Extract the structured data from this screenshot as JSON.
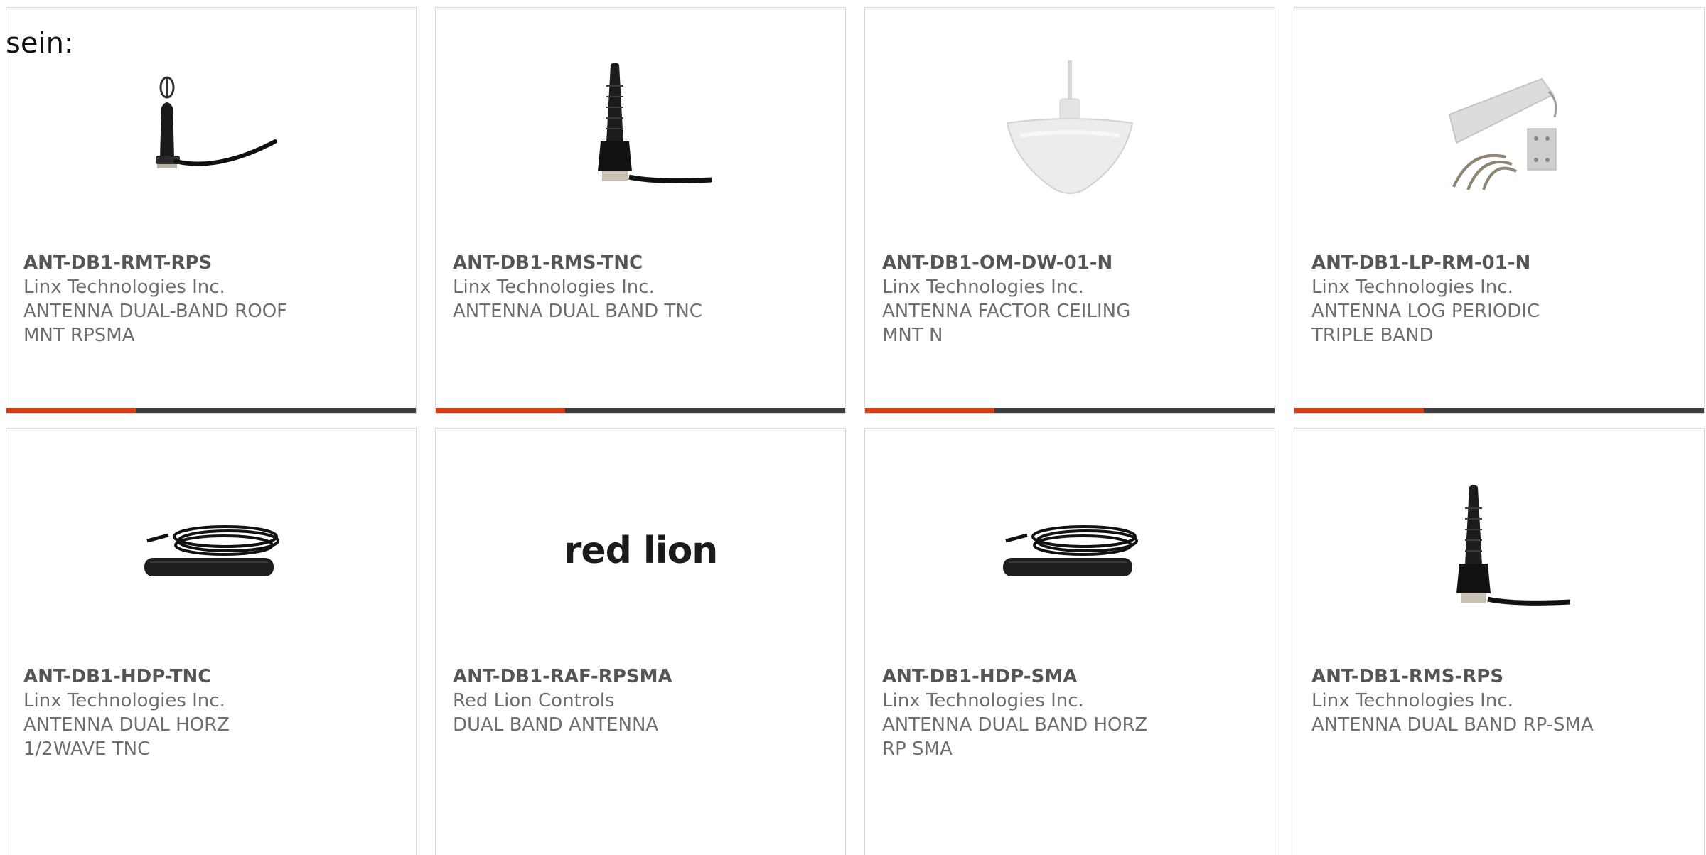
{
  "intro": {
    "text": "sein:"
  },
  "products": [
    {
      "part": "ANT-DB1-RMT-RPS",
      "manufacturer": "Linx Technologies Inc.",
      "description": "ANTENNA DUAL-BAND ROOF MNT RPSMA",
      "image": "roof-mount-antenna"
    },
    {
      "part": "ANT-DB1-RMS-TNC",
      "manufacturer": "Linx Technologies Inc.",
      "description": "ANTENNA DUAL BAND TNC",
      "image": "whip-antenna"
    },
    {
      "part": "ANT-DB1-OM-DW-01-N",
      "manufacturer": "Linx Technologies Inc.",
      "description": "ANTENNA FACTOR CEILING MNT N",
      "image": "ceiling-dome-antenna"
    },
    {
      "part": "ANT-DB1-LP-RM-01-N",
      "manufacturer": "Linx Technologies Inc.",
      "description": "ANTENNA LOG PERIODIC TRIPLE BAND",
      "image": "log-periodic-antenna"
    },
    {
      "part": "ANT-DB1-HDP-TNC",
      "manufacturer": "Linx Technologies Inc.",
      "description": "ANTENNA DUAL HORZ 1/2WAVE TNC",
      "image": "flat-cable-antenna"
    },
    {
      "part": "ANT-DB1-RAF-RPSMA",
      "manufacturer": "Red Lion Controls",
      "description": "DUAL BAND ANTENNA",
      "image": "red-lion-logo",
      "logo_text": "red lion"
    },
    {
      "part": "ANT-DB1-HDP-SMA",
      "manufacturer": "Linx Technologies Inc.",
      "description": "ANTENNA DUAL BAND HORZ RP SMA",
      "image": "flat-cable-antenna"
    },
    {
      "part": "ANT-DB1-RMS-RPS",
      "manufacturer": "Linx Technologies Inc.",
      "description": "ANTENNA DUAL BAND RP-SMA",
      "image": "whip-antenna"
    }
  ],
  "colors": {
    "accent": "#d93c13",
    "bar": "#3d3d3d",
    "border": "#d8d8d8",
    "text": "#6e6e6e"
  }
}
